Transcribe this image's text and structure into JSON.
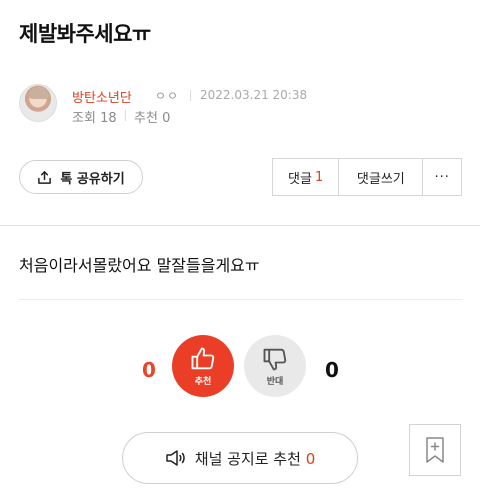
{
  "post": {
    "title": "제발봐주세요ㅠ",
    "author": "방탄소년단",
    "grade": "ㅇㅇ",
    "date": "2022.03.21 20:38",
    "views_label": "조회",
    "views": "18",
    "recommend_label": "추천",
    "recommend_count": "0",
    "body": "처음이라서몰랐어요 말잘들을게요ㅠ"
  },
  "actions": {
    "share_label": "톡 공유하기",
    "comment_label": "댓글",
    "comment_count": "1",
    "write_comment_label": "댓글쓰기",
    "more_label": "···"
  },
  "vote": {
    "up_count": "0",
    "up_label": "추천",
    "down_label": "반대",
    "down_count": "0"
  },
  "notice": {
    "label": "채널 공지로 추천",
    "count": "0"
  },
  "colors": {
    "accent": "#ea3f26",
    "author": "#d9401f"
  },
  "icons": {
    "share": "share-icon",
    "thumbs_up": "thumbs-up-icon",
    "thumbs_down": "thumbs-down-icon",
    "megaphone": "megaphone-icon",
    "bookmark": "bookmark-add-icon"
  }
}
